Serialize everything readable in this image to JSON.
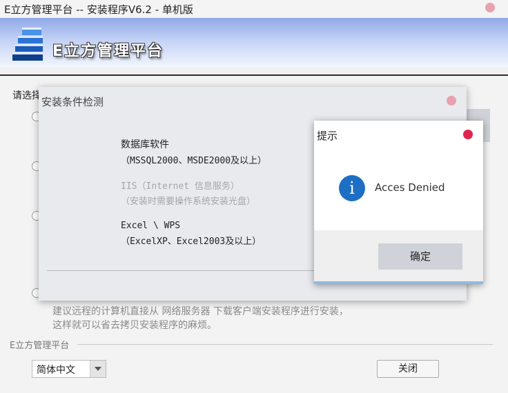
{
  "window": {
    "title": "E立方管理平台 -- 安装程序V6.2 - 单机版",
    "logo_text": "E立方管理平台"
  },
  "main": {
    "choose_label": "请选择",
    "hint_lines": [
      "建议远程的计算机直接从 网络服务器 下载客户端安装程序进行安装，",
      "这样就可以省去拷贝安装程序的麻烦。"
    ],
    "group_label": "E立方管理平台",
    "language_value": "简体中文",
    "close_label": "关闭"
  },
  "env_dialog": {
    "title": "安装条件检测",
    "requirements": [
      {
        "name": "数据库软件",
        "detail": "（MSSQL2000、MSDE2000及以上）"
      },
      {
        "name": "IIS（Internet 信息服务）",
        "detail": "（安装时需要操作系统安装光盘）"
      },
      {
        "name": "Excel \\ WPS",
        "detail": "（ExcelXP、Excel2003及以上）"
      }
    ]
  },
  "alert": {
    "title": "提示",
    "message": "Acces Denied",
    "icon_glyph": "i",
    "ok_label": "确定"
  },
  "colors": {
    "close_dot_light": "#e8a1b0",
    "close_dot_alert": "#e0264f",
    "info_blue": "#1e6fc3"
  }
}
